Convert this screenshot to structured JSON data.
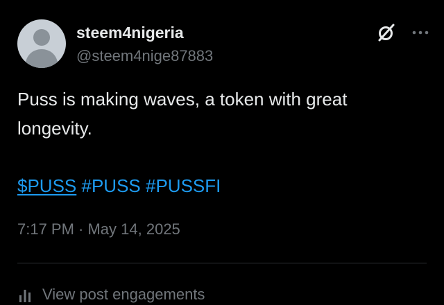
{
  "tweet": {
    "author": {
      "display_name": "steem4nigeria",
      "handle": "@steem4nige87883",
      "avatar_icon": "default-avatar-icon"
    },
    "actions": {
      "grok_icon": "grok-icon",
      "more_icon": "more-options-icon"
    },
    "text": "Puss is making waves, a token with great longevity.",
    "tags": [
      "$PUSS",
      "#PUSS",
      "#PUSSFI"
    ],
    "timestamp": "7:17 PM · May 14, 2025",
    "engagements_label": "View post engagements",
    "engagements_icon": "analytics-bars-icon"
  },
  "colors": {
    "background": "#000000",
    "primary_text": "#e7e9ea",
    "secondary_text": "#71767b",
    "link": "#1d9bf0",
    "divider": "#2f3336",
    "avatar_bg": "#c8cfd6",
    "avatar_fg": "#8a9299"
  }
}
